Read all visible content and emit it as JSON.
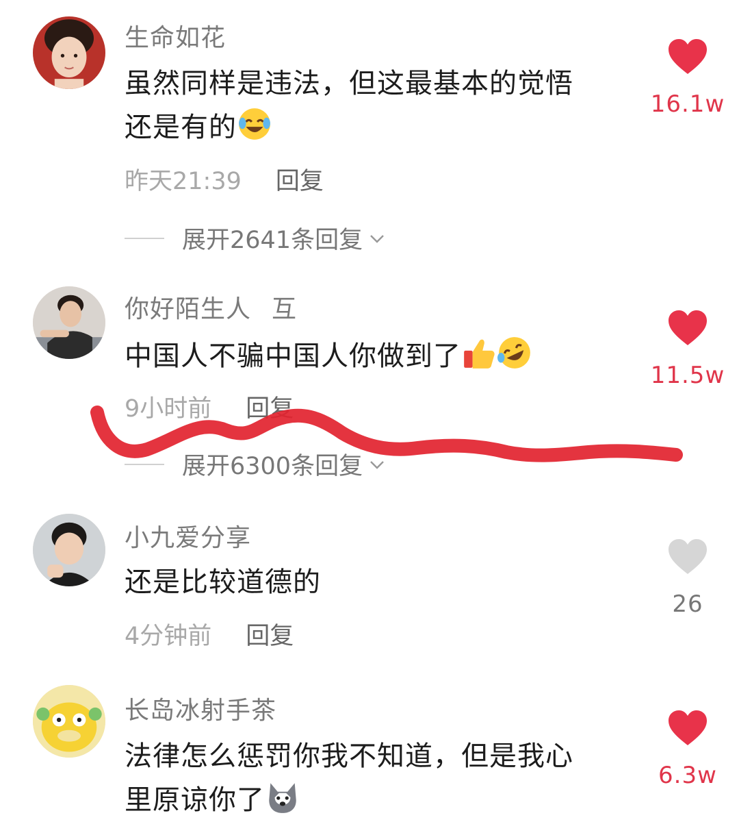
{
  "colors": {
    "like_red": "#e8334a",
    "like_gray": "#d6d6d6",
    "scribble_red": "#e2232f"
  },
  "comments": [
    {
      "username": "生命如花",
      "tag": "",
      "content_lines": [
        "虽然同样是违法，但这最基本的觉悟",
        "还是有的"
      ],
      "emoji": [
        "laugh-cry-emoji"
      ],
      "time": "昨天21:39",
      "reply_label": "回复",
      "expand_label": "展开2641条回复",
      "likes": "16.1w",
      "liked": true
    },
    {
      "username": "你好陌生人",
      "tag": "互",
      "content_lines": [
        "中国人不骗中国人你做到了"
      ],
      "emoji": [
        "thumbs-up-emoji",
        "rofl-emoji"
      ],
      "time": "9小时前",
      "reply_label": "回复",
      "expand_label": "展开6300条回复",
      "likes": "11.5w",
      "liked": true
    },
    {
      "username": "小九爱分享",
      "tag": "",
      "content_lines": [
        "还是比较道德的"
      ],
      "emoji": [],
      "time": "4分钟前",
      "reply_label": "回复",
      "expand_label": "",
      "likes": "26",
      "liked": false
    },
    {
      "username": "长岛冰射手茶",
      "tag": "",
      "content_lines": [
        "法律怎么惩罚你我不知道，但是我心",
        "里原谅你了"
      ],
      "emoji": [
        "husky-dog-emoji"
      ],
      "time": "",
      "reply_label": "",
      "expand_label": "",
      "likes": "6.3w",
      "liked": true
    }
  ]
}
